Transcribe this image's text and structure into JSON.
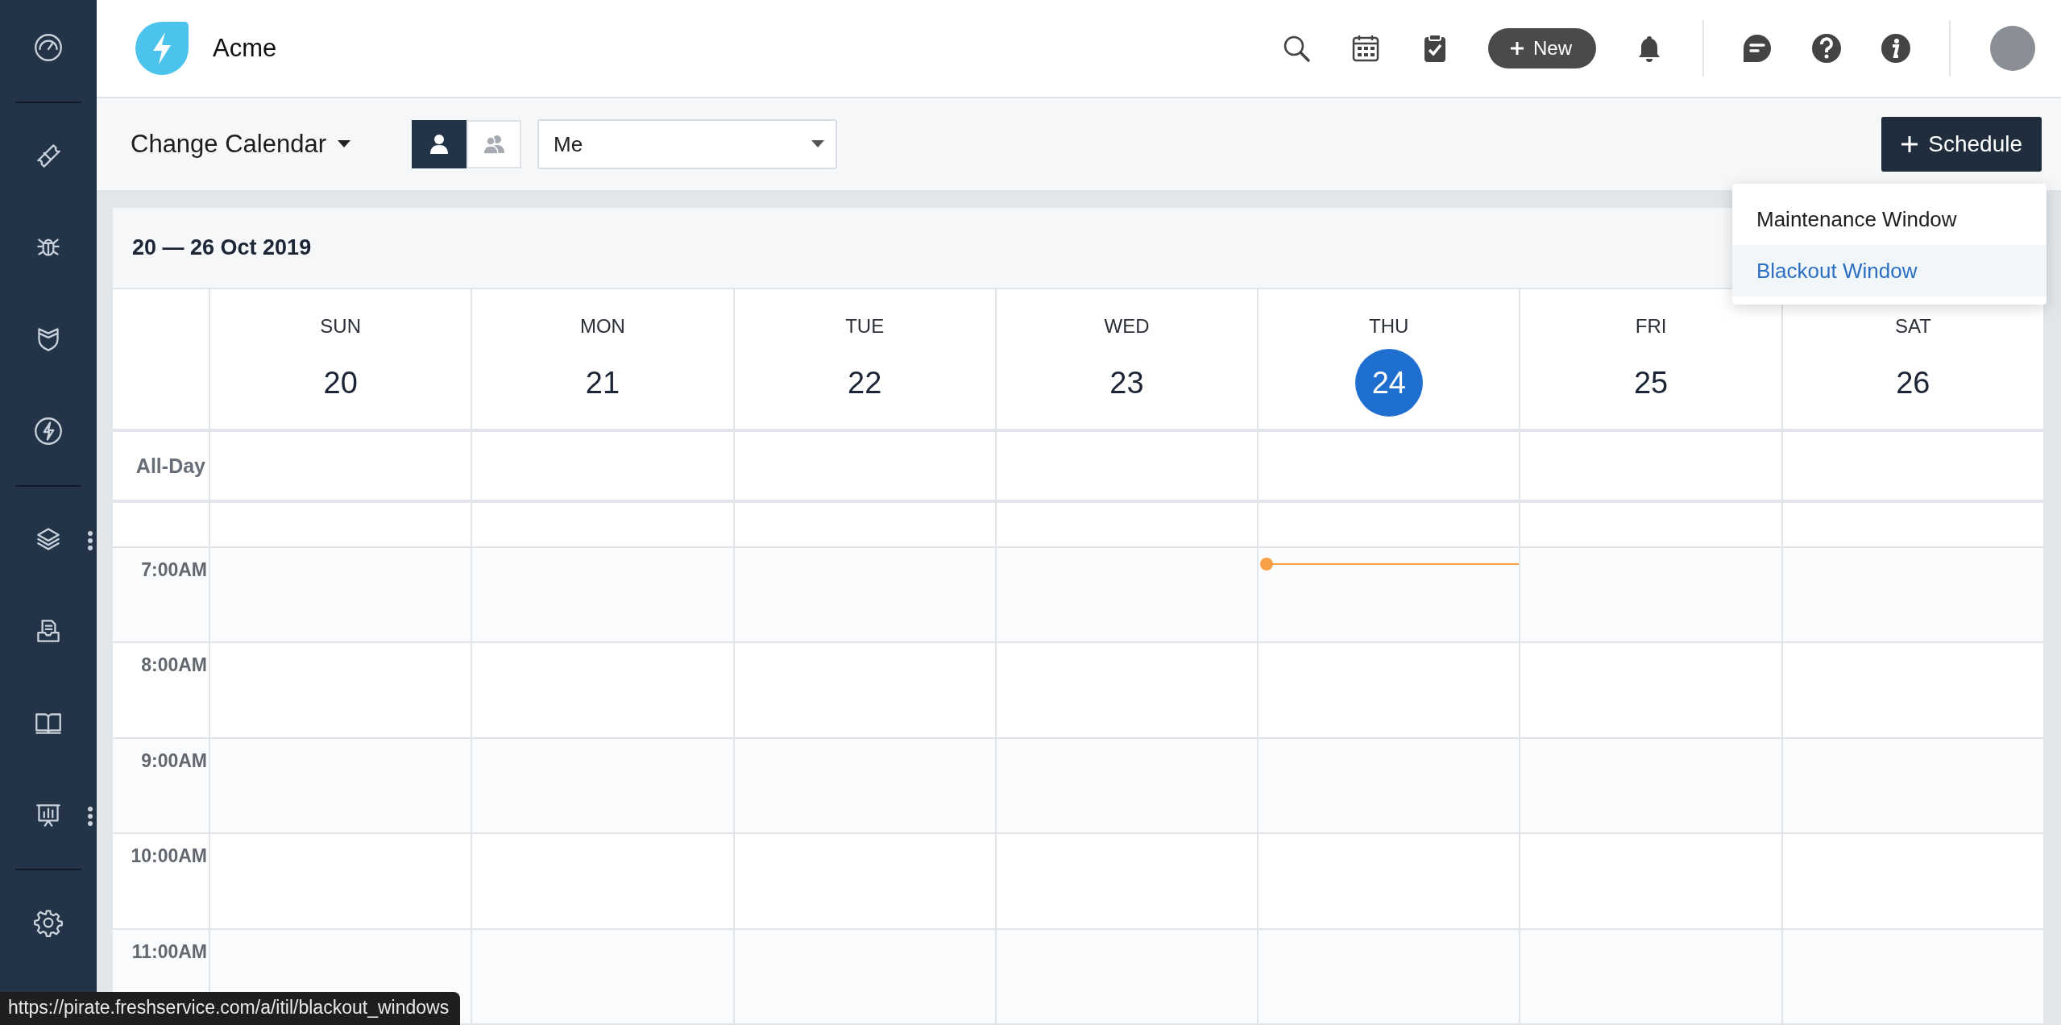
{
  "sidebar": {
    "groups": [
      {
        "items": [
          {
            "kind": "gauge",
            "has_menu": false
          }
        ]
      },
      {
        "items": [
          {
            "kind": "ticket",
            "has_menu": false
          },
          {
            "kind": "bug",
            "has_menu": false
          },
          {
            "kind": "shield",
            "has_menu": false
          },
          {
            "kind": "bolt",
            "has_menu": false
          }
        ]
      },
      {
        "items": [
          {
            "kind": "layers",
            "has_menu": true
          },
          {
            "kind": "inbox",
            "has_menu": false
          },
          {
            "kind": "book",
            "has_menu": false
          },
          {
            "kind": "chart",
            "has_menu": true
          }
        ]
      },
      {
        "items": [
          {
            "kind": "gear",
            "has_menu": false
          }
        ]
      }
    ]
  },
  "topbar": {
    "brand": "Acme",
    "actions": [
      {
        "kind": "search"
      },
      {
        "kind": "calendar"
      },
      {
        "kind": "clipboard"
      },
      {
        "kind": "new",
        "label": "New"
      },
      {
        "kind": "bell"
      },
      {
        "kind": "divider"
      },
      {
        "kind": "chat"
      },
      {
        "kind": "help"
      },
      {
        "kind": "info"
      },
      {
        "kind": "divider"
      },
      {
        "kind": "avatar"
      }
    ]
  },
  "subheader": {
    "title": "Change Calendar",
    "view_toggle": [
      {
        "kind": "person",
        "selected": true
      },
      {
        "kind": "people",
        "selected": false
      }
    ],
    "agent_select": {
      "value": "Me"
    },
    "schedule_button": {
      "label": "Schedule"
    },
    "schedule_menu": {
      "open": true,
      "items": [
        {
          "label": "Maintenance Window",
          "selected": false
        },
        {
          "label": "Blackout Window",
          "selected": true
        }
      ]
    }
  },
  "calendar": {
    "range": "20 — 26 Oct 2019",
    "all_day_label": "All-Day",
    "days": [
      {
        "name": "SUN",
        "date": "20",
        "selected": false
      },
      {
        "name": "MON",
        "date": "21",
        "selected": false
      },
      {
        "name": "TUE",
        "date": "22",
        "selected": false
      },
      {
        "name": "WED",
        "date": "23",
        "selected": false
      },
      {
        "name": "THU",
        "date": "24",
        "selected": true
      },
      {
        "name": "FRI",
        "date": "25",
        "selected": false
      },
      {
        "name": "SAT",
        "date": "26",
        "selected": false
      }
    ],
    "times": [
      "7:00AM",
      "8:00AM",
      "9:00AM",
      "10:00AM",
      "11:00AM"
    ]
  },
  "status_bar": {
    "link_preview": "https://pirate.freshservice.com/a/itil/blackout_windows"
  }
}
